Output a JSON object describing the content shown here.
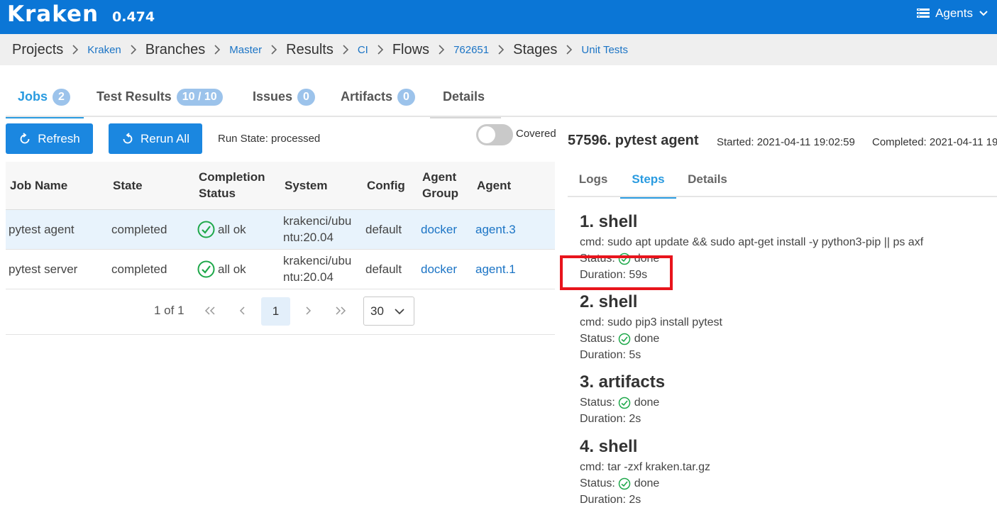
{
  "app": {
    "name": "Kraken",
    "version": "0.474"
  },
  "topbar": {
    "agents_label": "Agents"
  },
  "breadcrumb": {
    "projects": "Projects",
    "project": "Kraken",
    "branches": "Branches",
    "branch": "Master",
    "results": "Results",
    "result": "CI",
    "flows": "Flows",
    "flow": "762651",
    "stages": "Stages",
    "stage": "Unit Tests"
  },
  "tabs": {
    "jobs": {
      "label": "Jobs",
      "count": "2"
    },
    "test_results": {
      "label": "Test Results",
      "count": "10 / 10"
    },
    "issues": {
      "label": "Issues",
      "count": "0"
    },
    "artifacts": {
      "label": "Artifacts",
      "count": "0"
    },
    "details": {
      "label": "Details"
    }
  },
  "toolbar": {
    "refresh": "Refresh",
    "rerun_all": "Rerun All",
    "run_state": "Run State: processed",
    "covered_label": "Covered",
    "covered_on": false
  },
  "table": {
    "headers": {
      "job_name": "Job Name",
      "state": "State",
      "completion_1": "Completion",
      "completion_2": "Status",
      "system": "System",
      "config": "Config",
      "agent_group_1": "Agent",
      "agent_group_2": "Group",
      "agent": "Agent"
    },
    "rows": [
      {
        "name": "pytest agent",
        "state": "completed",
        "completion": "all ok",
        "system_1": "krakenci/ubu",
        "system_2": "ntu:20.04",
        "config": "default",
        "agent_group": "docker",
        "agent": "agent.3"
      },
      {
        "name": "pytest server",
        "state": "completed",
        "completion": "all ok",
        "system_1": "krakenci/ubu",
        "system_2": "ntu:20.04",
        "config": "default",
        "agent_group": "docker",
        "agent": "agent.1"
      }
    ]
  },
  "pagination": {
    "summary": "1 of 1",
    "current": "1",
    "page_size": "30"
  },
  "job_detail": {
    "title": "57596. pytest agent",
    "started": "Started: 2021-04-11 19:02:59",
    "completed": "Completed: 2021-04-11 19",
    "tabs": {
      "logs": "Logs",
      "steps": "Steps",
      "details": "Details"
    },
    "steps": [
      {
        "title": "1. shell",
        "cmd": "cmd: sudo apt update && sudo apt-get install -y python3-pip || ps axf",
        "status_label": "Status:",
        "status": "done",
        "duration": "Duration: 59s"
      },
      {
        "title": "2. shell",
        "cmd": "cmd: sudo pip3 install pytest",
        "status_label": "Status:",
        "status": "done",
        "duration": "Duration: 5s"
      },
      {
        "title": "3. artifacts",
        "status_label": "Status:",
        "status": "done",
        "duration": "Duration: 2s"
      },
      {
        "title": "4. shell",
        "cmd": "cmd: tar -zxf kraken.tar.gz",
        "status_label": "Status:",
        "status": "done",
        "duration": "Duration: 2s"
      }
    ]
  },
  "colors": {
    "topbar": "#0b76d6",
    "accent": "#2a9be0",
    "button": "#1b87e0",
    "ok_green": "#1ea84a",
    "highlight": "#e8141c"
  },
  "icons": [
    "menu-list-icon",
    "chevron-down-icon",
    "chevron-right-icon",
    "refresh-icon",
    "undo-icon",
    "check-circle-icon",
    "double-chevron-left-icon",
    "chevron-left-icon",
    "double-chevron-right-icon"
  ]
}
